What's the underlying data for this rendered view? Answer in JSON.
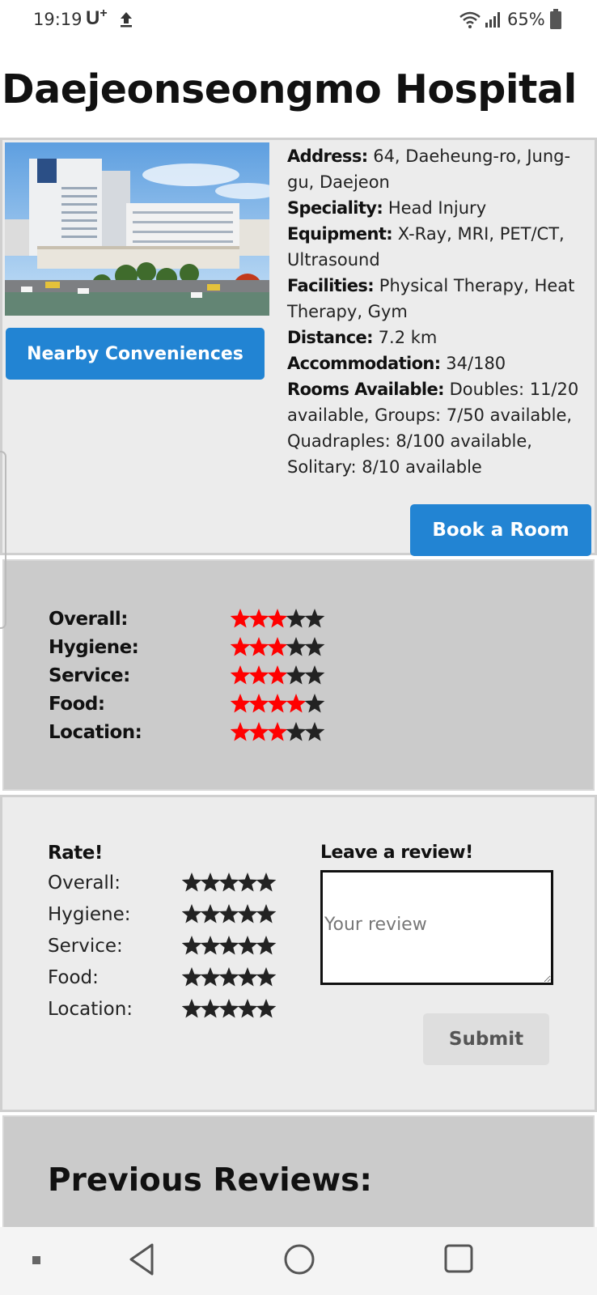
{
  "status_bar": {
    "time": "19:19",
    "carrier": "U",
    "carrier_plus": "+",
    "battery": "65%",
    "icons": [
      "upload-icon",
      "wifi-icon",
      "signal-icon",
      "battery-icon"
    ]
  },
  "page": {
    "title": "Daejeonseongmo Hospital"
  },
  "hospital": {
    "photo_icon": "hospital-photo",
    "nearby_label": "Nearby Conveniences",
    "book_label": "Book a Room",
    "details": [
      {
        "label": "Address:",
        "value": "64, Daeheung-ro, Jung-gu, Daejeon"
      },
      {
        "label": "Speciality:",
        "value": "Head Injury"
      },
      {
        "label": "Equipment:",
        "value": "X-Ray, MRI, PET/CT, Ultrasound"
      },
      {
        "label": "Facilities:",
        "value": "Physical Therapy, Heat Therapy, Gym"
      },
      {
        "label": "Distance:",
        "value": "7.2 km"
      },
      {
        "label": "Accommodation:",
        "value": "34/180"
      },
      {
        "label": "Rooms Available:",
        "value": "Doubles: 11/20 available, Groups: 7/50 available, Quadraples: 8/100 available, Solitary: 8/10 available"
      }
    ]
  },
  "ratings": {
    "star_color_filled": "#ff0000",
    "star_color_empty": "#222222",
    "max": 5,
    "items": [
      {
        "label": "Overall:",
        "score": 3
      },
      {
        "label": "Hygiene:",
        "score": 3
      },
      {
        "label": "Service:",
        "score": 3
      },
      {
        "label": "Food:",
        "score": 4
      },
      {
        "label": "Location:",
        "score": 3
      }
    ]
  },
  "rate": {
    "title": "Rate!",
    "items": [
      {
        "label": "Overall:"
      },
      {
        "label": "Hygiene:"
      },
      {
        "label": "Service:"
      },
      {
        "label": "Food:"
      },
      {
        "label": "Location:"
      }
    ],
    "review_title": "Leave a review!",
    "review_placeholder": "Your review",
    "submit_label": "Submit"
  },
  "previous_reviews": {
    "title": "Previous Reviews:"
  },
  "nav_bar": {
    "icons": [
      "menu-dot-icon",
      "back-icon",
      "home-icon",
      "recents-icon"
    ]
  },
  "colors": {
    "accent": "#2284d3",
    "card_light": "#ececec",
    "card_dark": "#cbcbcb"
  }
}
